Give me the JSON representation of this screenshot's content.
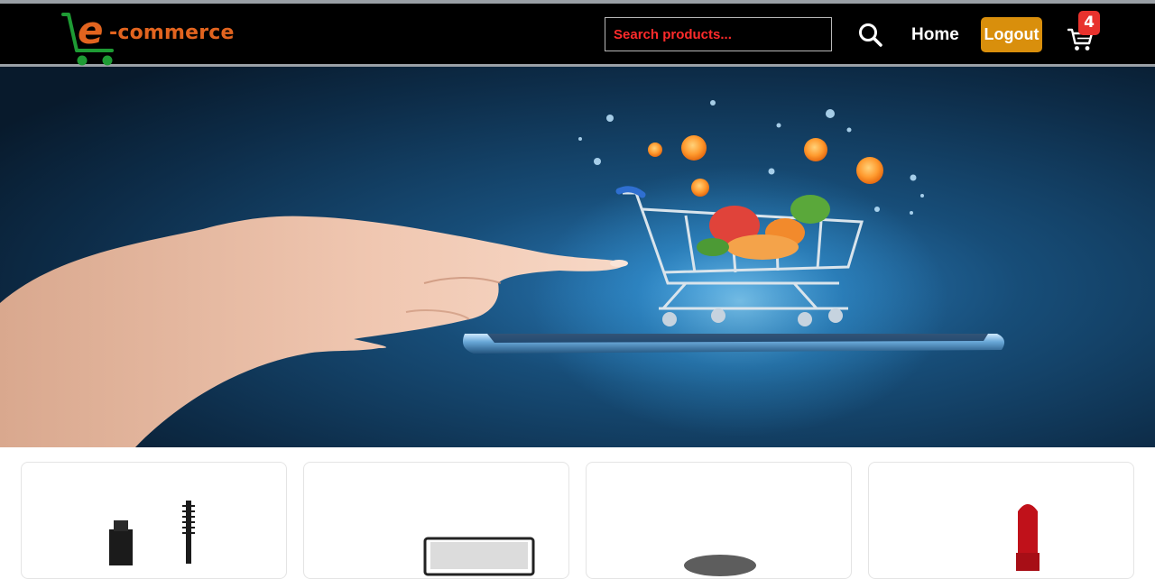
{
  "header": {
    "logo": {
      "letter": "e",
      "text": "-commerce",
      "cart_icon": "cart-logo-icon",
      "letter_color": "#e2641f",
      "cart_color": "#1e9b34"
    },
    "search": {
      "placeholder": "Search products...",
      "value": "",
      "icon": "search-icon"
    },
    "nav": {
      "home_label": "Home",
      "logout_label": "Logout"
    },
    "cart": {
      "icon": "shopping-cart-icon",
      "count": "4"
    }
  },
  "hero": {
    "image": "hand-pointing-at-shopping-cart-on-smartphone"
  },
  "products": [
    {
      "image": "mascara"
    },
    {
      "image": "makeup-palette"
    },
    {
      "image": "face-powder"
    },
    {
      "image": "red-lipstick"
    }
  ],
  "colors": {
    "navbar_bg": "#000000",
    "search_text": "#ff2b2b",
    "logout_bg": "#d98f0c",
    "badge_bg": "#e8322d",
    "hero_bg": "#0e2c47"
  }
}
